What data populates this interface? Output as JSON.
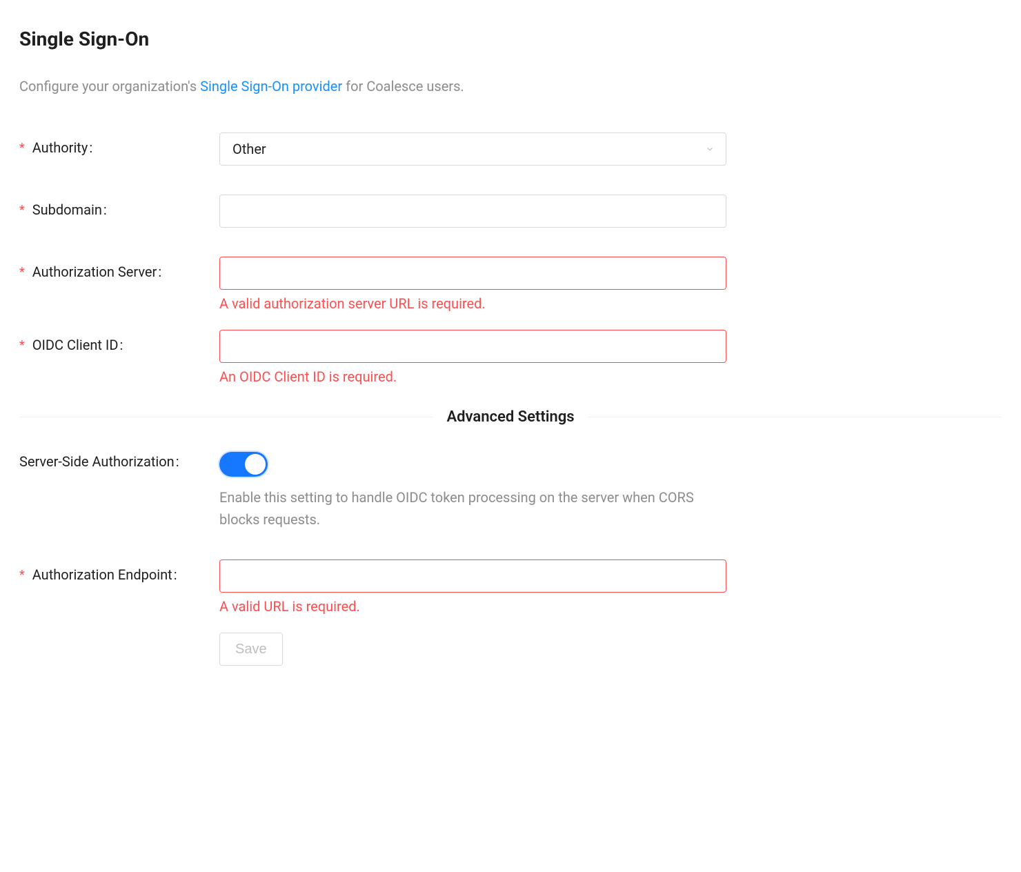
{
  "title": "Single Sign-On",
  "subtitle": {
    "prefix": "Configure your organization's ",
    "link": "Single Sign-On provider",
    "suffix": " for Coalesce users."
  },
  "fields": {
    "authority": {
      "label": "Authority",
      "value": "Other"
    },
    "subdomain": {
      "label": "Subdomain",
      "value": ""
    },
    "authServer": {
      "label": "Authorization Server",
      "value": "",
      "error": "A valid authorization server URL is required."
    },
    "oidcClientId": {
      "label": "OIDC Client ID",
      "value": "",
      "error": "An OIDC Client ID is required."
    },
    "serverSideAuth": {
      "label": "Server-Side Authorization",
      "help": "Enable this setting to handle OIDC token processing on the server when CORS blocks requests."
    },
    "authEndpoint": {
      "label": "Authorization Endpoint",
      "value": "",
      "error": "A valid URL is required."
    }
  },
  "divider": "Advanced Settings",
  "saveLabel": "Save"
}
